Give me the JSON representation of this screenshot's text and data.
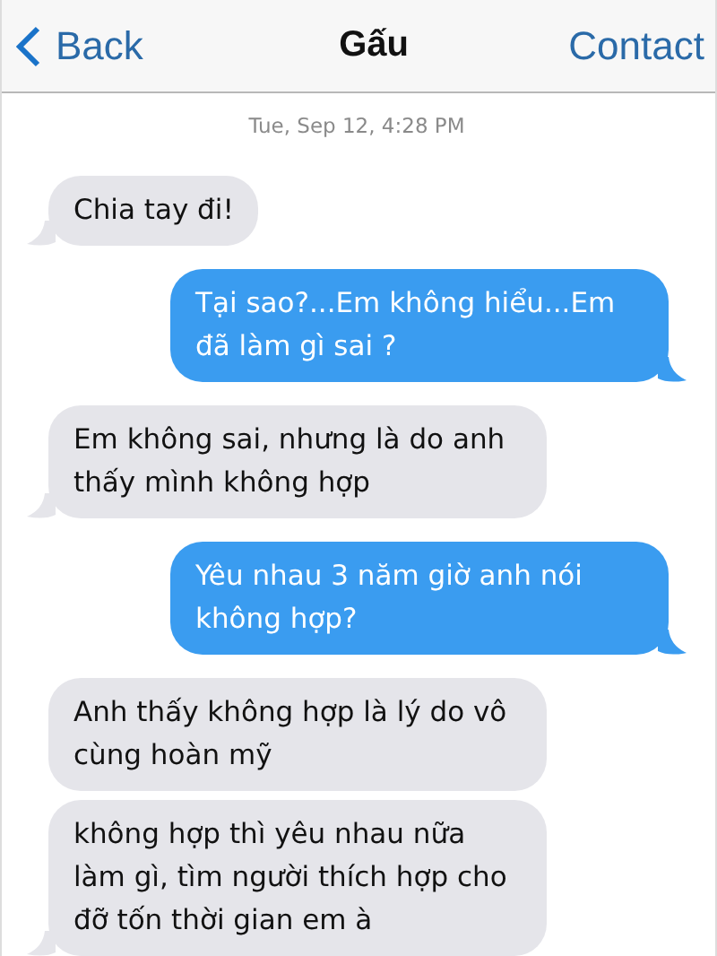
{
  "nav": {
    "back": "Back",
    "title": "Gấu",
    "contact": "Contact"
  },
  "timestamp": "Tue, Sep 12, 4:28 PM",
  "messages": [
    {
      "kind": "received",
      "text": "Chia tay đi!",
      "tail": true
    },
    {
      "kind": "sent",
      "text": "Tại sao?...Em không hiểu...Em đã làm gì sai ?",
      "tail": true
    },
    {
      "kind": "received",
      "text": "Em không sai, nhưng là do anh thấy mình không hợp",
      "tail": true
    },
    {
      "kind": "sent",
      "text": "Yêu nhau 3 năm giờ anh nói không hợp?",
      "tail": true
    },
    {
      "kind": "received",
      "text": "Anh thấy không hợp là lý do vô cùng hoàn mỹ",
      "tail": false
    },
    {
      "kind": "received",
      "text": "không hợp thì yêu nhau nữa làm gì, tìm người thích hợp cho đỡ tốn thời gian em à",
      "tail": true
    }
  ]
}
